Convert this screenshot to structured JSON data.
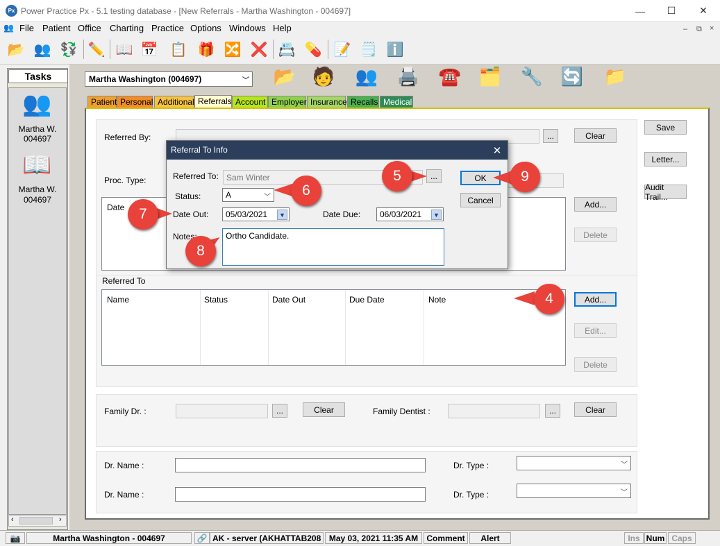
{
  "window": {
    "title": "Power Practice Px - 5.1 testing database - [New Referrals - Martha Washington - 004697]",
    "app_badge": "Px",
    "minimize": "—",
    "maximize": "☐",
    "close": "✕"
  },
  "menu": [
    "File",
    "Patient",
    "Office",
    "Charting",
    "Practice",
    "Options",
    "Windows",
    "Help"
  ],
  "mdi_controls": [
    "–",
    "⧉",
    "×"
  ],
  "tasks": {
    "header": "Tasks",
    "items": [
      {
        "name": "Martha W.",
        "id": "004697",
        "icon": "patients-icon"
      },
      {
        "name": "Martha W.",
        "id": "004697",
        "icon": "book-icon"
      }
    ]
  },
  "patient_selector": {
    "value": "Martha Washington (004697)"
  },
  "tabs": [
    {
      "label": "Patient",
      "color": "#f0a030"
    },
    {
      "label": "Personal",
      "color": "#f28c28"
    },
    {
      "label": "Additional",
      "color": "#f5c242"
    },
    {
      "label": "Referrals",
      "color": "#fffbd0",
      "active": true
    },
    {
      "label": "Account",
      "color": "#b5e61d"
    },
    {
      "label": "Employer",
      "color": "#8fd14f"
    },
    {
      "label": "Insurance",
      "color": "#a5d66c"
    },
    {
      "label": "Recalls",
      "color": "#4cb050"
    },
    {
      "label": "Medical",
      "color": "#2e8b57"
    }
  ],
  "referred_by": {
    "label": "Referred By:",
    "browse": "...",
    "clear": "Clear"
  },
  "proc_type": {
    "label": "Proc. Type:"
  },
  "top_grid": {
    "column": "Date",
    "add": "Add...",
    "delete": "Delete"
  },
  "side_buttons": {
    "save": "Save",
    "letter": "Letter...",
    "audit": "Audit Trail..."
  },
  "referred_to": {
    "label": "Referred To",
    "columns": [
      "Name",
      "Status",
      "Date Out",
      "Due Date",
      "Note"
    ],
    "add": "Add...",
    "edit": "Edit...",
    "delete": "Delete"
  },
  "family": {
    "dr_label": "Family Dr. :",
    "dentist_label": "Family Dentist :",
    "browse": "...",
    "clear": "Clear"
  },
  "dr_rows": [
    {
      "name_label": "Dr. Name :",
      "type_label": "Dr. Type :"
    },
    {
      "name_label": "Dr. Name :",
      "type_label": "Dr. Type :"
    }
  ],
  "dialog": {
    "title": "Referral To Info",
    "close": "✕",
    "referred_to_label": "Referred To:",
    "referred_to_value": "Sam Winter",
    "browse": "...",
    "status_label": "Status:",
    "status_value": "A",
    "date_out_label": "Date Out:",
    "date_out_value": "05/03/2021",
    "date_due_label": "Date Due:",
    "date_due_value": "06/03/2021",
    "notes_label": "Notes:",
    "notes_value": "Ortho Candidate.",
    "ok": "OK",
    "cancel": "Cancel"
  },
  "callouts": [
    "4",
    "5",
    "6",
    "7",
    "8",
    "9"
  ],
  "statusbar": {
    "patient": "Martha Washington - 004697",
    "server": "AK - server (AKHATTAB208",
    "datetime": "May 03, 2021 11:35 AM",
    "comment": "Comment",
    "alert": "Alert",
    "ins": "Ins",
    "num": "Num",
    "caps": "Caps"
  },
  "colors": {
    "dialog_title_bg": "#2b3e5c",
    "callout": "#e8423a",
    "focus_border": "#0078d7"
  }
}
